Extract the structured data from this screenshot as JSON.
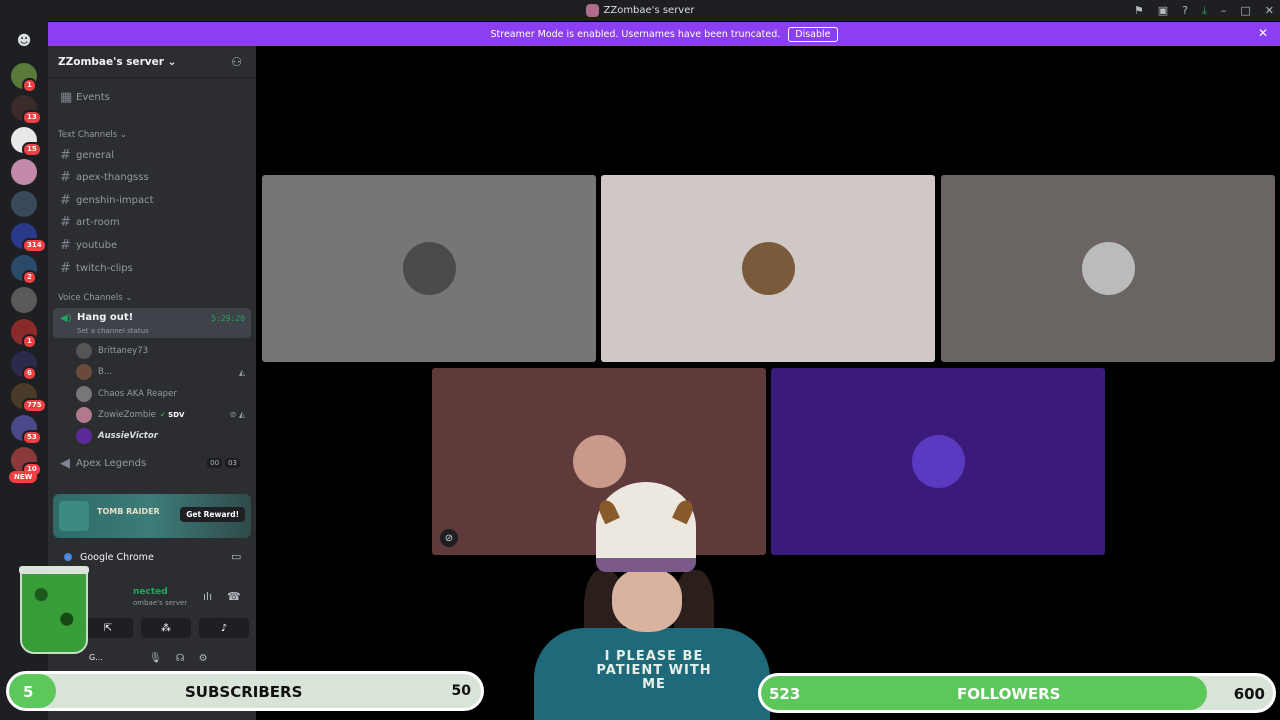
{
  "window": {
    "title": "ZZombae's server"
  },
  "banner": {
    "text": "Streamer Mode is enabled. Usernames have been truncated.",
    "disable_label": "Disable"
  },
  "guild_badges": [
    {
      "count": "1",
      "color": "#5a7a3a"
    },
    {
      "count": "13",
      "color": "#3a2a2a"
    },
    {
      "count": "15",
      "color": "#e8e8e8"
    },
    {
      "count": "",
      "color": "#c28aa8"
    },
    {
      "count": "",
      "color": "#3a4a5a"
    },
    {
      "count": "314",
      "color": "#2a3a8a"
    },
    {
      "count": "2",
      "color": "#2a4a6a"
    },
    {
      "count": "",
      "color": "#5a5a5a"
    },
    {
      "count": "1",
      "color": "#8a2a2a"
    },
    {
      "count": "6",
      "color": "#2a2a4a"
    },
    {
      "count": "775",
      "color": "#4a3a2a"
    },
    {
      "count": "53",
      "color": "#4a4a8a"
    },
    {
      "count": "10",
      "color": "#8a3a3a"
    }
  ],
  "new_badge": "NEW",
  "server": {
    "name": "ZZombae's server",
    "events_label": "Events",
    "text_category": "Text Channels",
    "text_channels": [
      "general",
      "apex-thangsss",
      "genshin-impact",
      "art-room",
      "youtube",
      "twitch-clips"
    ],
    "voice_category": "Voice Channels",
    "voice_channel": {
      "name": "Hang out!",
      "status": "Set a channel status",
      "time": "5:29:20"
    },
    "voice_users": [
      {
        "name": "Brittaney73",
        "color": "#555"
      },
      {
        "name": "B...",
        "color": "#6a4a3a"
      },
      {
        "name": "Chaos AKA Reaper",
        "color": "#777"
      },
      {
        "name": "ZowieZombie",
        "color": "#b07a8a"
      },
      {
        "name": "AussieVictor",
        "color": "#5a2a9a"
      }
    ],
    "sdv_badge": "SDV",
    "apex_channel": {
      "name": "Apex Legends",
      "count1": "00",
      "count2": "03"
    }
  },
  "reward": {
    "game": "TOMB RAIDER",
    "button": "Get Reward!"
  },
  "panel": {
    "app": "Google Chrome",
    "status": "nected",
    "server": "ombae's server",
    "user_fragment": "G..."
  },
  "tiles": [
    {
      "bg": "#767676",
      "avatar": "#4a4a4a"
    },
    {
      "bg": "#d0c8c4",
      "avatar": "#7a5a3a"
    },
    {
      "bg": "#6a6462",
      "avatar": "#bbb"
    },
    {
      "bg": "#5e3a3a",
      "avatar": "#c99a8a"
    },
    {
      "bg": "#3a1a7a",
      "avatar": "#5a3ac0"
    }
  ],
  "webcam": {
    "shirt_text": "I PLEASE BE PATIENT WITH ME"
  },
  "subscribers": {
    "current": "5",
    "label": "SUBSCRIBERS",
    "goal": "50",
    "progress": 0.1
  },
  "followers": {
    "current": "523",
    "label": "FOLLOWERS",
    "goal": "600",
    "progress": 0.872
  }
}
